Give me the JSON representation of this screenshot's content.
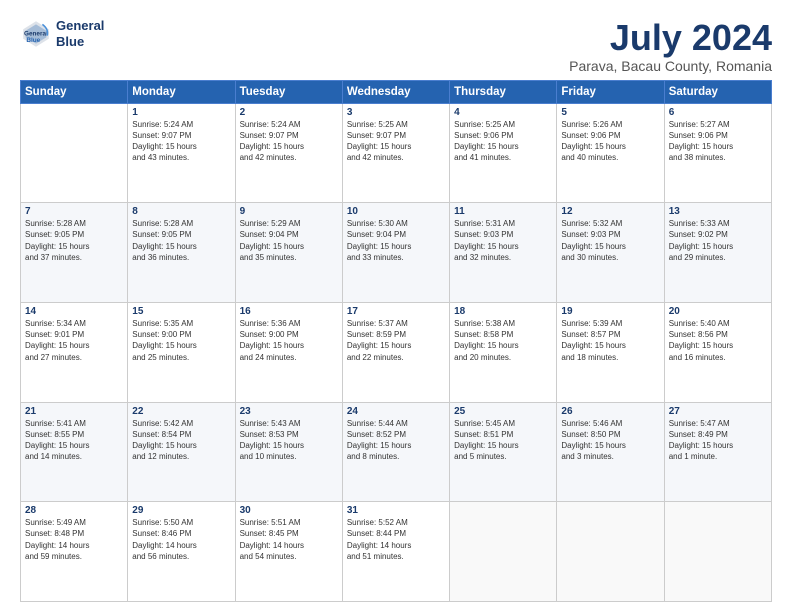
{
  "header": {
    "logo_line1": "General",
    "logo_line2": "Blue",
    "title": "July 2024",
    "subtitle": "Parava, Bacau County, Romania"
  },
  "weekdays": [
    "Sunday",
    "Monday",
    "Tuesday",
    "Wednesday",
    "Thursday",
    "Friday",
    "Saturday"
  ],
  "weeks": [
    [
      {
        "day": "",
        "info": ""
      },
      {
        "day": "1",
        "info": "Sunrise: 5:24 AM\nSunset: 9:07 PM\nDaylight: 15 hours\nand 43 minutes."
      },
      {
        "day": "2",
        "info": "Sunrise: 5:24 AM\nSunset: 9:07 PM\nDaylight: 15 hours\nand 42 minutes."
      },
      {
        "day": "3",
        "info": "Sunrise: 5:25 AM\nSunset: 9:07 PM\nDaylight: 15 hours\nand 42 minutes."
      },
      {
        "day": "4",
        "info": "Sunrise: 5:25 AM\nSunset: 9:06 PM\nDaylight: 15 hours\nand 41 minutes."
      },
      {
        "day": "5",
        "info": "Sunrise: 5:26 AM\nSunset: 9:06 PM\nDaylight: 15 hours\nand 40 minutes."
      },
      {
        "day": "6",
        "info": "Sunrise: 5:27 AM\nSunset: 9:06 PM\nDaylight: 15 hours\nand 38 minutes."
      }
    ],
    [
      {
        "day": "7",
        "info": "Sunrise: 5:28 AM\nSunset: 9:05 PM\nDaylight: 15 hours\nand 37 minutes."
      },
      {
        "day": "8",
        "info": "Sunrise: 5:28 AM\nSunset: 9:05 PM\nDaylight: 15 hours\nand 36 minutes."
      },
      {
        "day": "9",
        "info": "Sunrise: 5:29 AM\nSunset: 9:04 PM\nDaylight: 15 hours\nand 35 minutes."
      },
      {
        "day": "10",
        "info": "Sunrise: 5:30 AM\nSunset: 9:04 PM\nDaylight: 15 hours\nand 33 minutes."
      },
      {
        "day": "11",
        "info": "Sunrise: 5:31 AM\nSunset: 9:03 PM\nDaylight: 15 hours\nand 32 minutes."
      },
      {
        "day": "12",
        "info": "Sunrise: 5:32 AM\nSunset: 9:03 PM\nDaylight: 15 hours\nand 30 minutes."
      },
      {
        "day": "13",
        "info": "Sunrise: 5:33 AM\nSunset: 9:02 PM\nDaylight: 15 hours\nand 29 minutes."
      }
    ],
    [
      {
        "day": "14",
        "info": "Sunrise: 5:34 AM\nSunset: 9:01 PM\nDaylight: 15 hours\nand 27 minutes."
      },
      {
        "day": "15",
        "info": "Sunrise: 5:35 AM\nSunset: 9:00 PM\nDaylight: 15 hours\nand 25 minutes."
      },
      {
        "day": "16",
        "info": "Sunrise: 5:36 AM\nSunset: 9:00 PM\nDaylight: 15 hours\nand 24 minutes."
      },
      {
        "day": "17",
        "info": "Sunrise: 5:37 AM\nSunset: 8:59 PM\nDaylight: 15 hours\nand 22 minutes."
      },
      {
        "day": "18",
        "info": "Sunrise: 5:38 AM\nSunset: 8:58 PM\nDaylight: 15 hours\nand 20 minutes."
      },
      {
        "day": "19",
        "info": "Sunrise: 5:39 AM\nSunset: 8:57 PM\nDaylight: 15 hours\nand 18 minutes."
      },
      {
        "day": "20",
        "info": "Sunrise: 5:40 AM\nSunset: 8:56 PM\nDaylight: 15 hours\nand 16 minutes."
      }
    ],
    [
      {
        "day": "21",
        "info": "Sunrise: 5:41 AM\nSunset: 8:55 PM\nDaylight: 15 hours\nand 14 minutes."
      },
      {
        "day": "22",
        "info": "Sunrise: 5:42 AM\nSunset: 8:54 PM\nDaylight: 15 hours\nand 12 minutes."
      },
      {
        "day": "23",
        "info": "Sunrise: 5:43 AM\nSunset: 8:53 PM\nDaylight: 15 hours\nand 10 minutes."
      },
      {
        "day": "24",
        "info": "Sunrise: 5:44 AM\nSunset: 8:52 PM\nDaylight: 15 hours\nand 8 minutes."
      },
      {
        "day": "25",
        "info": "Sunrise: 5:45 AM\nSunset: 8:51 PM\nDaylight: 15 hours\nand 5 minutes."
      },
      {
        "day": "26",
        "info": "Sunrise: 5:46 AM\nSunset: 8:50 PM\nDaylight: 15 hours\nand 3 minutes."
      },
      {
        "day": "27",
        "info": "Sunrise: 5:47 AM\nSunset: 8:49 PM\nDaylight: 15 hours\nand 1 minute."
      }
    ],
    [
      {
        "day": "28",
        "info": "Sunrise: 5:49 AM\nSunset: 8:48 PM\nDaylight: 14 hours\nand 59 minutes."
      },
      {
        "day": "29",
        "info": "Sunrise: 5:50 AM\nSunset: 8:46 PM\nDaylight: 14 hours\nand 56 minutes."
      },
      {
        "day": "30",
        "info": "Sunrise: 5:51 AM\nSunset: 8:45 PM\nDaylight: 14 hours\nand 54 minutes."
      },
      {
        "day": "31",
        "info": "Sunrise: 5:52 AM\nSunset: 8:44 PM\nDaylight: 14 hours\nand 51 minutes."
      },
      {
        "day": "",
        "info": ""
      },
      {
        "day": "",
        "info": ""
      },
      {
        "day": "",
        "info": ""
      }
    ]
  ]
}
